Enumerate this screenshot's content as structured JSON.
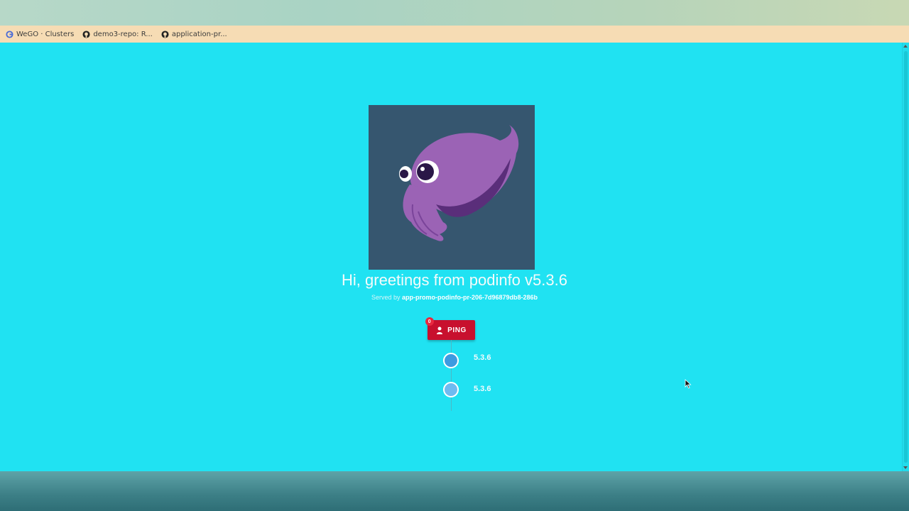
{
  "bookmarks": [
    {
      "label": "WeGO · Clusters",
      "icon": "google-icon"
    },
    {
      "label": "demo3-repo: R...",
      "icon": "github-icon"
    },
    {
      "label": "application-pr...",
      "icon": "github-icon"
    }
  ],
  "main": {
    "logo": "podinfo-cuttlefish-logo",
    "greeting": "Hi, greetings from podinfo v5.3.6",
    "served_prefix": "Served by",
    "served_host": "app-promo-podinfo-pr-206-7d96879db8-286b",
    "ping_button": {
      "label": "PING",
      "badge": "0",
      "icon": "person-icon"
    },
    "timeline": [
      {
        "label": "5.3.6",
        "color": "#3d9be0"
      },
      {
        "label": "5.3.6",
        "color": "#6fbbf0"
      }
    ]
  },
  "colors": {
    "page_background": "#20e2f2",
    "bookmark_bar": "#f6dcb4",
    "ping_button": "#c8102e",
    "logo_background": "#36566f"
  }
}
